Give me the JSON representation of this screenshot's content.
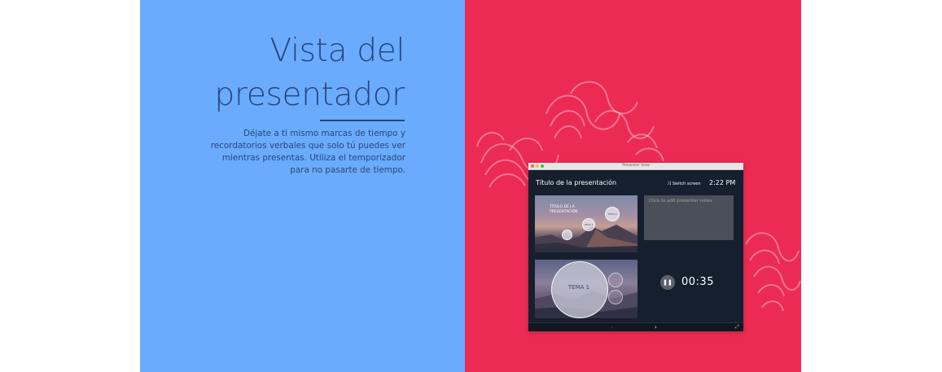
{
  "section": {
    "heading_line1": "Vista del",
    "heading_line2": "presentador",
    "description_lines": [
      "Déjate a ti mismo marcas de tiempo y",
      "recordatorios verbales que solo tú puedes ver",
      "mientras presentas. Utiliza el temporizador",
      "para no pasarte de tiempo."
    ]
  },
  "colors": {
    "left_panel": "#6aabfe",
    "right_panel": "#ec2b53",
    "heading_text": "#27477c"
  },
  "presenter_window": {
    "window_title": "Presenter View",
    "presentation_title": "Título de la presentación",
    "switch_screen_label": "Switch screen",
    "clock": "2:22 PM",
    "slide_title": "TÍTULO DE LA PRESENTACIÓN",
    "bubble_labels": [
      "TEMA 2",
      "TEMA 1"
    ],
    "notes_placeholder": "Click to add presenter notes",
    "current_topic": "TEMA 1",
    "timer": "00:35",
    "icons": [
      "pause-icon",
      "chevron-left-icon",
      "chevron-right-icon",
      "expand-icon",
      "switch-screen-icon"
    ]
  }
}
